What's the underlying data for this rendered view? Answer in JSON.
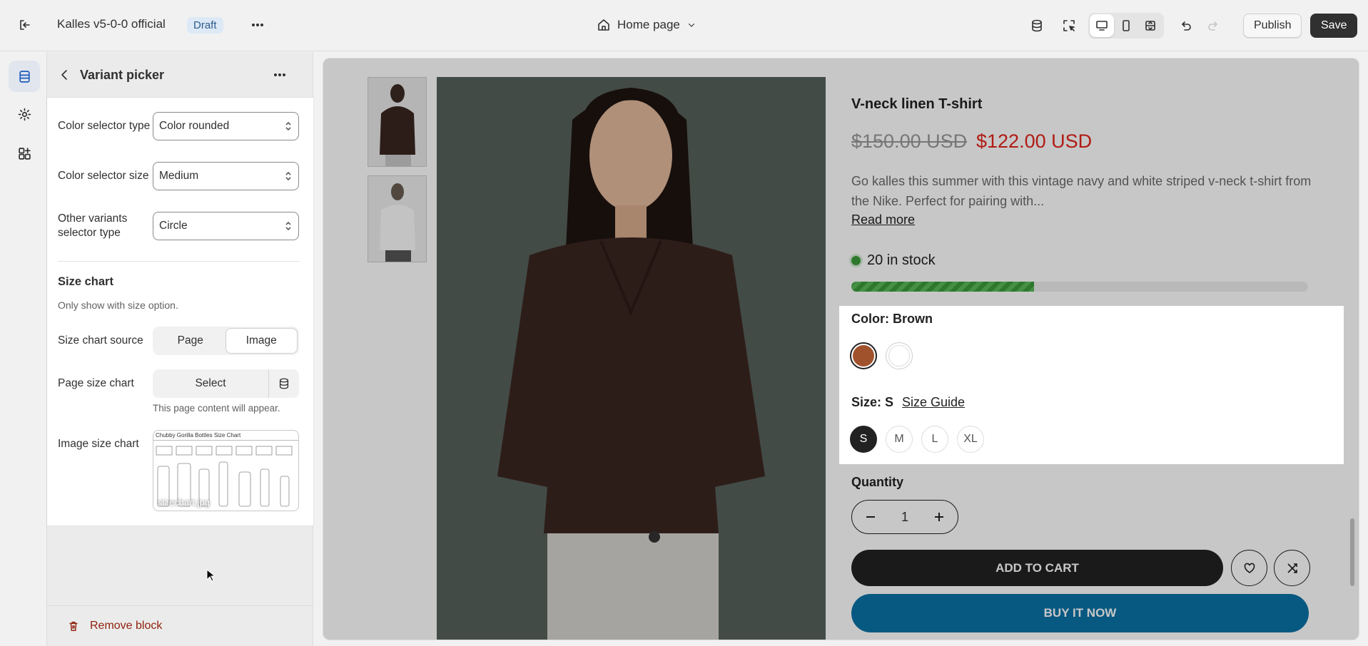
{
  "topbar": {
    "store_name": "Kalles v5-0-0 official",
    "status_badge": "Draft",
    "page_selector": "Home page",
    "publish_label": "Publish",
    "save_label": "Save"
  },
  "panel": {
    "title": "Variant picker",
    "fields": [
      {
        "label": "Color selector type",
        "value": "Color rounded"
      },
      {
        "label": "Color selector size",
        "value": "Medium"
      },
      {
        "label": "Other variants selector type",
        "value": "Circle"
      }
    ],
    "size_chart": {
      "heading": "Size chart",
      "help": "Only show with size option.",
      "source_label": "Size chart source",
      "source_options": [
        "Page",
        "Image"
      ],
      "source_selected": "Image",
      "page_label": "Page size chart",
      "page_select_label": "Select",
      "page_help": "This page content will appear.",
      "image_label": "Image size chart",
      "image_title": "Chubby Gorilla Bottles Size Chart",
      "image_filename": "sizechart.jpg"
    },
    "remove_label": "Remove block"
  },
  "product": {
    "title": "V-neck linen T-shirt",
    "price_old": "$150.00 USD",
    "price_new": "$122.00 USD",
    "description": "Go kalles this summer with this vintage navy and white striped v-neck t-shirt from the Nike. Perfect for pairing with...",
    "read_more": "Read more",
    "stock_text": "20 in stock",
    "stock_fraction": 0.4,
    "color_label": "Color: Brown",
    "colors": [
      "#a0522d",
      "#ffffff"
    ],
    "size_label": "Size: S",
    "size_guide": "Size Guide",
    "sizes": [
      "S",
      "M",
      "L",
      "XL"
    ],
    "selected_size": "S",
    "quantity_label": "Quantity",
    "quantity": "1",
    "add_to_cart": "ADD TO CART",
    "buy_now": "BUY IT NOW"
  }
}
